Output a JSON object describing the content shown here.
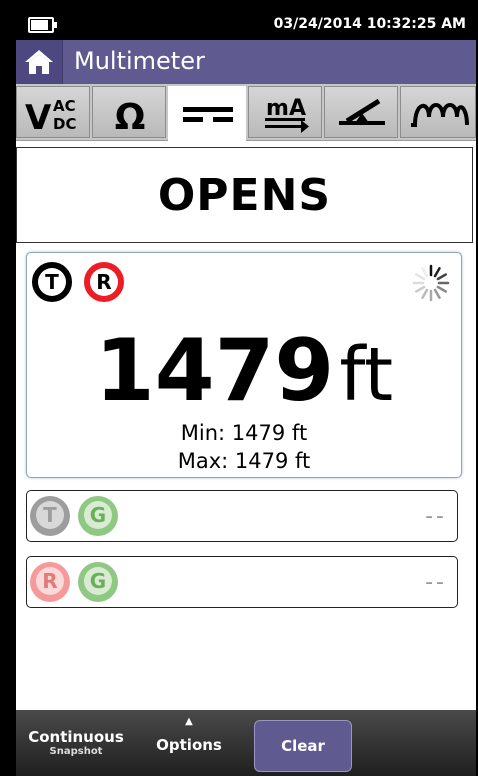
{
  "status_bar": {
    "datetime": "03/24/2014 10:32:25 AM",
    "battery_level": 0.75
  },
  "title_bar": {
    "title": "Multimeter"
  },
  "tabs": [
    {
      "name": "vac-dc",
      "icon": "vac-dc-icon",
      "label_main": "V",
      "label_top": "AC",
      "label_bottom": "DC"
    },
    {
      "name": "ohm",
      "icon": "ohm-icon",
      "label": "Ω"
    },
    {
      "name": "dc",
      "icon": "dc-lines-icon",
      "active": true
    },
    {
      "name": "ma",
      "icon": "milliamp-icon",
      "label": "mA"
    },
    {
      "name": "opens",
      "icon": "open-switch-icon"
    },
    {
      "name": "inductance",
      "icon": "coil-icon"
    }
  ],
  "mode": {
    "label": "OPENS"
  },
  "main_card": {
    "badge_1": "T",
    "badge_2": "R",
    "value": "1479",
    "unit": "ft",
    "min": "Min: 1479 ft",
    "max": "Max: 1479 ft"
  },
  "pairs": [
    {
      "badge_1": "T",
      "badge_2": "G",
      "value": "--"
    },
    {
      "badge_1": "R",
      "badge_2": "G",
      "value": "--"
    }
  ],
  "bottom_bar": {
    "continuous_label": "Continuous",
    "snapshot_label": "Snapshot",
    "options_label": "Options",
    "clear_label": "Clear"
  },
  "colors": {
    "accent": "#5f5a90",
    "red": "#ee1c24",
    "green": "#7cbd6e"
  }
}
